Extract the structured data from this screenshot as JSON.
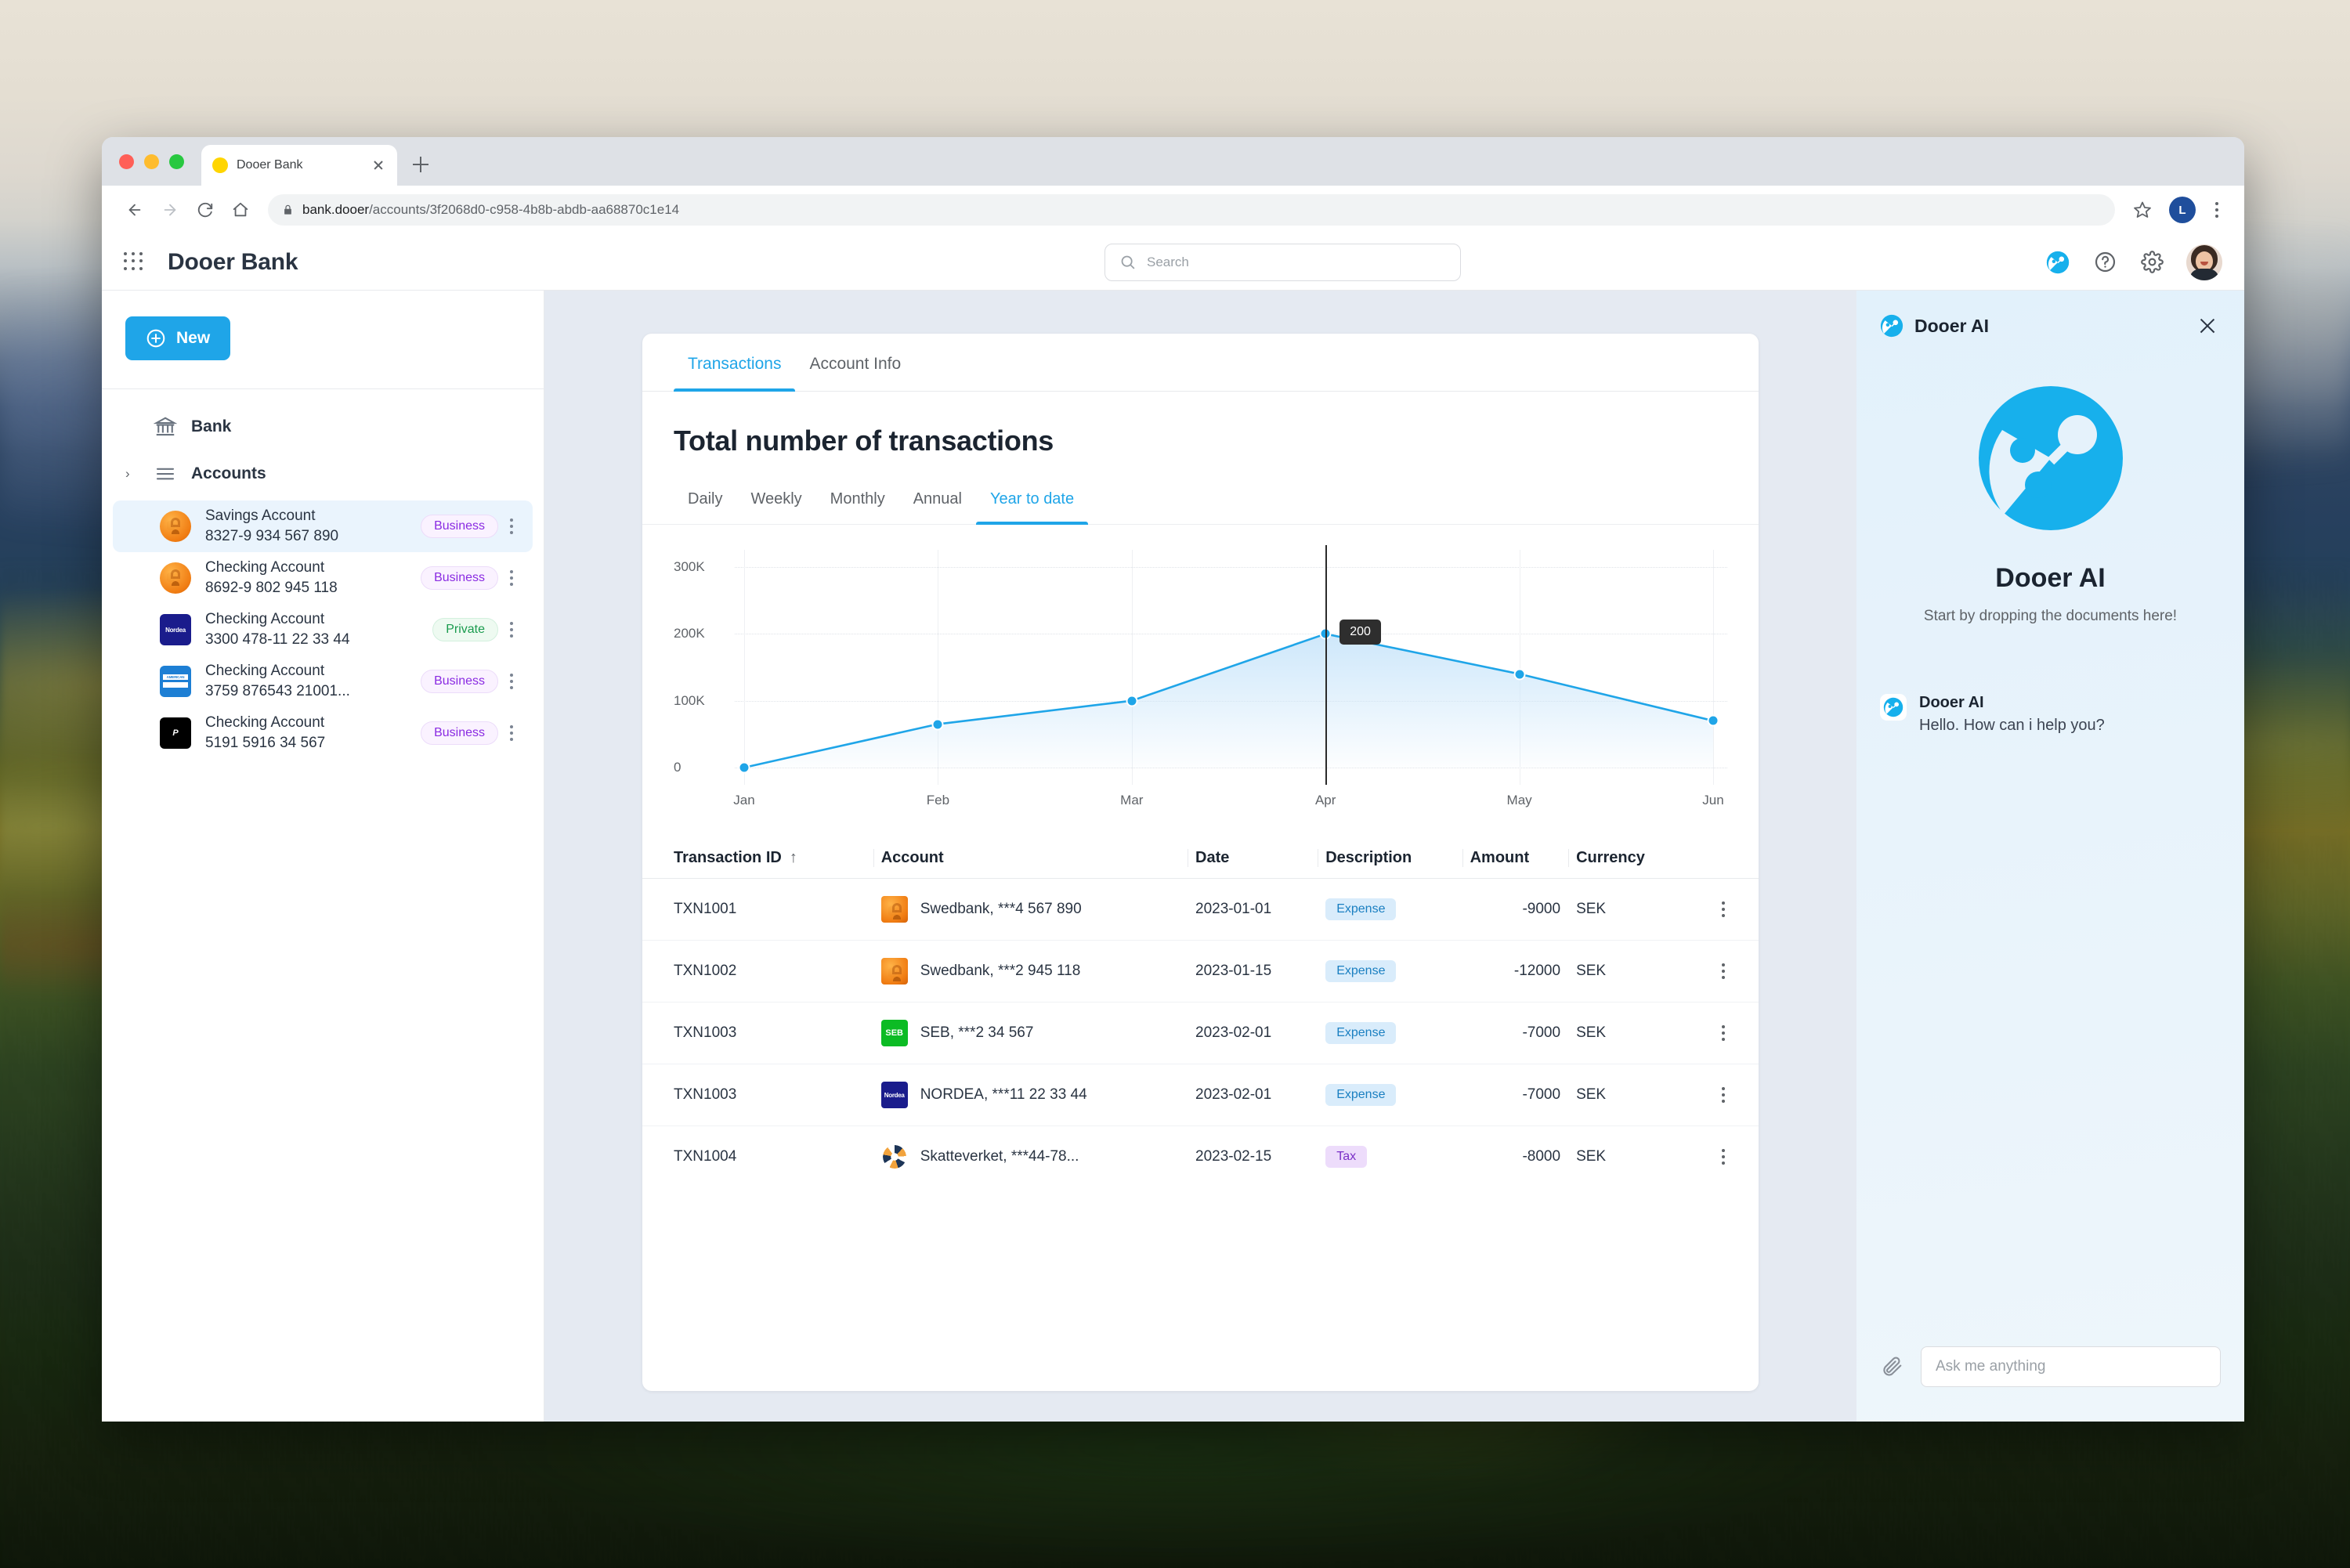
{
  "browser": {
    "tab": {
      "title": "Dooer Bank",
      "favicon": "circle-favicon",
      "close": "close-tab-icon"
    },
    "newtab_label": "+",
    "url_main": "bank.dooer",
    "url_path": "/accounts/3f2068d0-c958-4b8b-abdb-aa68870c1e14",
    "profile_initial": "L"
  },
  "header": {
    "brand": "Dooer Bank",
    "search_placeholder": "Search",
    "icons": [
      "dooer-ai-icon",
      "help-icon",
      "settings-gear-icon",
      "user-avatar"
    ]
  },
  "sidebar": {
    "new_label": "New",
    "bank_label": "Bank",
    "accounts_label": "Accounts",
    "accounts": [
      {
        "name": "Savings Account",
        "number": "8327-9 934 567 890",
        "tag": "Business",
        "tag_type": "business",
        "bank": "swedbank",
        "active": true
      },
      {
        "name": "Checking Account",
        "number": "8692-9 802 945 118",
        "tag": "Business",
        "tag_type": "business",
        "bank": "swedbank",
        "active": false
      },
      {
        "name": "Checking Account",
        "number": "3300 478-11 22 33 44",
        "tag": "Private",
        "tag_type": "private",
        "bank": "nordea",
        "active": false
      },
      {
        "name": "Checking Account",
        "number": "3759 876543 21001...",
        "tag": "Business",
        "tag_type": "business",
        "bank": "amex",
        "active": false
      },
      {
        "name": "Checking Account",
        "number": "5191 5916 34 567",
        "tag": "Business",
        "tag_type": "business",
        "bank": "pleo",
        "active": false
      }
    ]
  },
  "main": {
    "tabs": [
      {
        "label": "Transactions",
        "active": true
      },
      {
        "label": "Account Info",
        "active": false
      }
    ],
    "title": "Total number of transactions",
    "ranges": [
      {
        "label": "Daily",
        "active": false
      },
      {
        "label": "Weekly",
        "active": false
      },
      {
        "label": "Monthly",
        "active": false
      },
      {
        "label": "Annual",
        "active": false
      },
      {
        "label": "Year to date",
        "active": true
      }
    ],
    "table": {
      "columns": [
        "Transaction ID",
        "Account",
        "Date",
        "Description",
        "Amount",
        "Currency"
      ],
      "sort_column": "Transaction ID",
      "sort_direction": "asc",
      "rows": [
        {
          "id": "TXN1001",
          "bank": "swedbank",
          "account": "Swedbank, ***4 567 890",
          "date": "2023-01-01",
          "description": "Expense",
          "desc_type": "expense",
          "amount": "-9000",
          "currency": "SEK"
        },
        {
          "id": "TXN1002",
          "bank": "swedbank",
          "account": "Swedbank, ***2 945 118",
          "date": "2023-01-15",
          "description": "Expense",
          "desc_type": "expense",
          "amount": "-12000",
          "currency": "SEK"
        },
        {
          "id": "TXN1003",
          "bank": "seb",
          "account": "SEB, ***2 34 567",
          "date": "2023-02-01",
          "description": "Expense",
          "desc_type": "expense",
          "amount": "-7000",
          "currency": "SEK"
        },
        {
          "id": "TXN1003",
          "bank": "nordea",
          "account": "NORDEA, ***11 22 33 44",
          "date": "2023-02-01",
          "description": "Expense",
          "desc_type": "expense",
          "amount": "-7000",
          "currency": "SEK"
        },
        {
          "id": "TXN1004",
          "bank": "skatteverket",
          "account": "Skatteverket, ***44-78...",
          "date": "2023-02-15",
          "description": "Tax",
          "desc_type": "tax",
          "amount": "-8000",
          "currency": "SEK"
        }
      ]
    }
  },
  "chart_data": {
    "type": "area",
    "title": "Total number of transactions",
    "xlabel": "",
    "ylabel": "",
    "categories": [
      "Jan",
      "Feb",
      "Mar",
      "Apr",
      "May",
      "Jun"
    ],
    "values": [
      0,
      65000,
      100000,
      200000,
      140000,
      70000
    ],
    "ytick_labels": [
      "0",
      "100K",
      "200K",
      "300K"
    ],
    "ytick_values": [
      0,
      100000,
      200000,
      300000
    ],
    "ylim": [
      0,
      300000
    ],
    "grid": true,
    "legend": "none",
    "line_color": "#1fa5e8",
    "fill_color": "#cbe6fa",
    "tooltip": {
      "label": "200",
      "category": "Apr",
      "value": 200000
    }
  },
  "ai_panel": {
    "header_title": "Dooer AI",
    "close": "close-icon",
    "hero_title": "Dooer AI",
    "hero_subtitle": "Start by dropping the documents here!",
    "message": {
      "sender": "Dooer AI",
      "text": "Hello. How can i help you?"
    },
    "input_placeholder": "Ask me anything",
    "attach": "paperclip-icon"
  },
  "colors": {
    "accent": "#1fa5e8",
    "business_tag": "#8a2be2",
    "private_tag": "#1a9b4e",
    "expense_tag": "#1a7fc1",
    "tax_tag": "#7a2fc7"
  }
}
